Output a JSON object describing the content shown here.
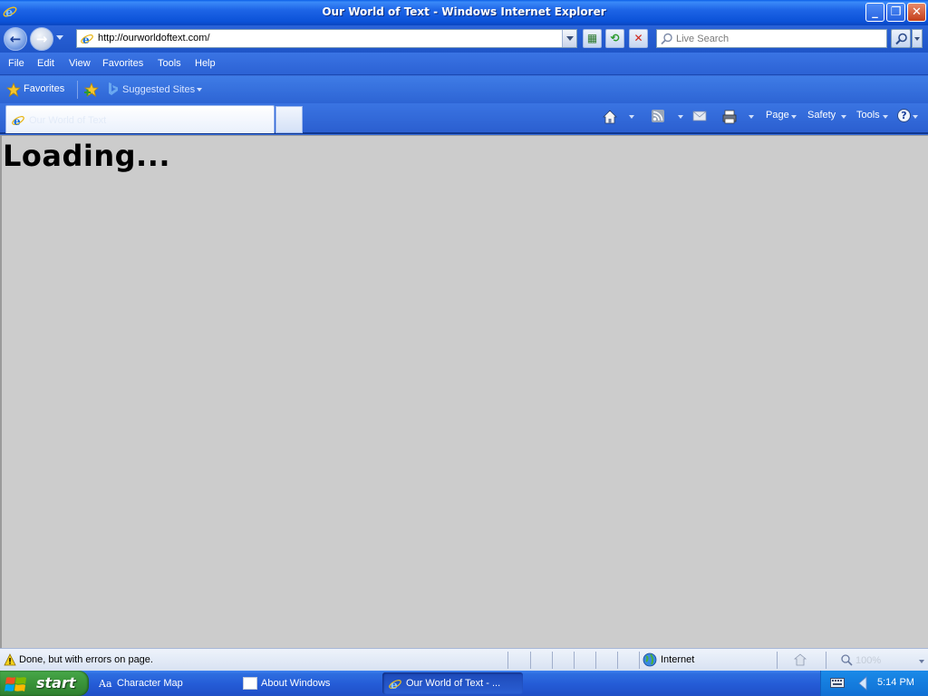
{
  "window": {
    "title": "Our World of Text - Windows Internet Explorer",
    "controls": {
      "minimize": "_",
      "maximize": "❐",
      "close": "✕"
    }
  },
  "address_bar": {
    "url": "http://ourworldoftext.com/"
  },
  "search": {
    "placeholder": "Live Search"
  },
  "menu": {
    "items": [
      "File",
      "Edit",
      "View",
      "Favorites",
      "Tools",
      "Help"
    ]
  },
  "favorites_bar": {
    "favorites_label": "Favorites",
    "suggested_sites_label": "Suggested Sites"
  },
  "tabs": [
    {
      "title": "Our World of Text",
      "active": true
    }
  ],
  "command_bar": {
    "page_label": "Page",
    "safety_label": "Safety",
    "tools_label": "Tools",
    "help_label": "?"
  },
  "content": {
    "heading": "Loading..."
  },
  "status_bar": {
    "message": "Done, but with errors on page.",
    "zone": "Internet",
    "zoom": "100%"
  },
  "taskbar": {
    "start_label": "start",
    "tasks": [
      {
        "label": "Character Map",
        "icon": "character-map-icon",
        "active": false
      },
      {
        "label": "About Windows",
        "icon": "window-icon",
        "active": false
      },
      {
        "label": "Our World of Text - ...",
        "icon": "ie-icon",
        "active": true
      }
    ],
    "clock": "5:14 PM"
  },
  "colors": {
    "title_bar": "#0b52d8",
    "content_bg": "#cccccc",
    "start_button": "#3c973c",
    "taskbar": "#245bd6"
  }
}
